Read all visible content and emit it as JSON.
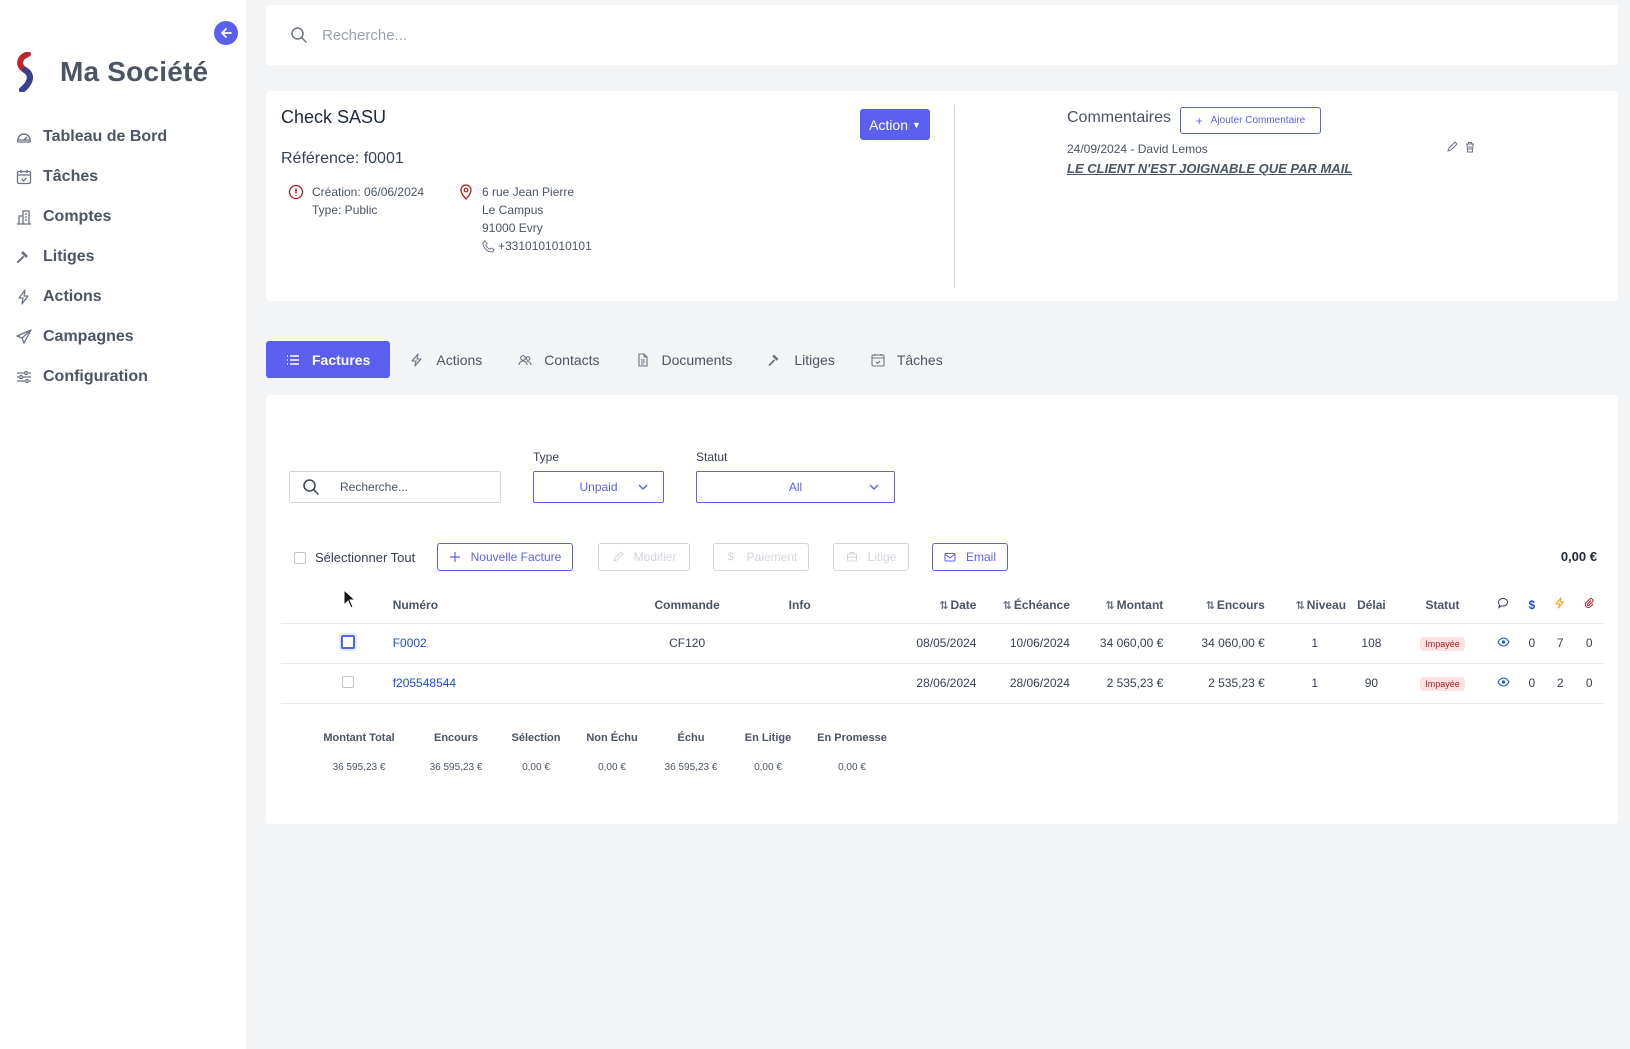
{
  "brand": {
    "name": "Ma Société"
  },
  "sidebar": {
    "items": [
      {
        "label": "Tableau de Bord",
        "icon": "dashboard-icon"
      },
      {
        "label": "Tâches",
        "icon": "calendar-check-icon"
      },
      {
        "label": "Comptes",
        "icon": "building-icon"
      },
      {
        "label": "Litiges",
        "icon": "gavel-icon"
      },
      {
        "label": "Actions",
        "icon": "bolt-icon"
      },
      {
        "label": "Campagnes",
        "icon": "send-icon"
      },
      {
        "label": "Configuration",
        "icon": "sliders-icon"
      }
    ]
  },
  "top_search": {
    "placeholder": "Recherche..."
  },
  "account": {
    "name": "Check SASU",
    "reference": "Référence: f0001",
    "action_label": "Action",
    "creation": "Création: 06/06/2024",
    "type": "Type: Public",
    "address_line1": "6 rue Jean Pierre",
    "address_line2": "Le Campus",
    "address_line3": "91000 Evry",
    "phone": "+3310101010101"
  },
  "comments": {
    "title": "Commentaires",
    "add_label": "Ajouter Commentaire",
    "items": [
      {
        "meta": "24/09/2024 - David Lemos",
        "text": "LE CLIENT N'EST JOIGNABLE QUE PAR MAIL"
      }
    ]
  },
  "tabs": [
    {
      "label": "Factures",
      "icon": "list-icon",
      "active": true
    },
    {
      "label": "Actions",
      "icon": "bolt-icon",
      "active": false
    },
    {
      "label": "Contacts",
      "icon": "users-icon",
      "active": false
    },
    {
      "label": "Documents",
      "icon": "document-icon",
      "active": false
    },
    {
      "label": "Litiges",
      "icon": "gavel-icon",
      "active": false
    },
    {
      "label": "Tâches",
      "icon": "calendar-check-icon",
      "active": false
    }
  ],
  "filters": {
    "search_placeholder": "Recherche...",
    "type_label": "Type",
    "type_value": "Unpaid",
    "status_label": "Statut",
    "status_value": "All"
  },
  "toolbar": {
    "select_all": "Sélectionner Tout",
    "new_invoice": "Nouvelle Facture",
    "modify": "Modifier",
    "payment": "Paiement",
    "dispute": "Litige",
    "email": "Email",
    "selected_total": "0,00 €"
  },
  "table": {
    "headers": {
      "numero": "Numéro",
      "commande": "Commande",
      "info": "Info",
      "date": "Date",
      "echeance": "Échéance",
      "montant": "Montant",
      "encours": "Encours",
      "niveau": "Niveau",
      "delai": "Délai",
      "statut": "Statut"
    },
    "rows": [
      {
        "numero": "F0002",
        "commande": "CF120",
        "info": "",
        "date": "08/05/2024",
        "echeance": "10/06/2024",
        "montant": "34 060,00 €",
        "encours": "34 060,00 €",
        "niveau": "1",
        "delai": "108",
        "statut": "Impayée",
        "comments": "0",
        "payments": "7",
        "attachments": "0"
      },
      {
        "numero": "f205548544",
        "commande": "",
        "info": "",
        "date": "28/06/2024",
        "echeance": "28/06/2024",
        "montant": "2 535,23 €",
        "encours": "2 535,23 €",
        "niveau": "1",
        "delai": "90",
        "statut": "Impayée",
        "comments": "0",
        "payments": "2",
        "attachments": "0"
      }
    ]
  },
  "summary": {
    "items": [
      {
        "label": "Montant Total",
        "value": "36 595,23 €"
      },
      {
        "label": "Encours",
        "value": "36 595,23 €"
      },
      {
        "label": "Sélection",
        "value": "0,00 €"
      },
      {
        "label": "Non Échu",
        "value": "0,00 €"
      },
      {
        "label": "Échu",
        "value": "36 595,23 €"
      },
      {
        "label": "En Litige",
        "value": "0,00 €"
      },
      {
        "label": "En Promesse",
        "value": "0,00 €"
      }
    ]
  },
  "colors": {
    "accent": "#5b5fef",
    "danger": "#b91c1c",
    "badge_bg": "#fde2e2",
    "link": "#1d4ed8"
  }
}
